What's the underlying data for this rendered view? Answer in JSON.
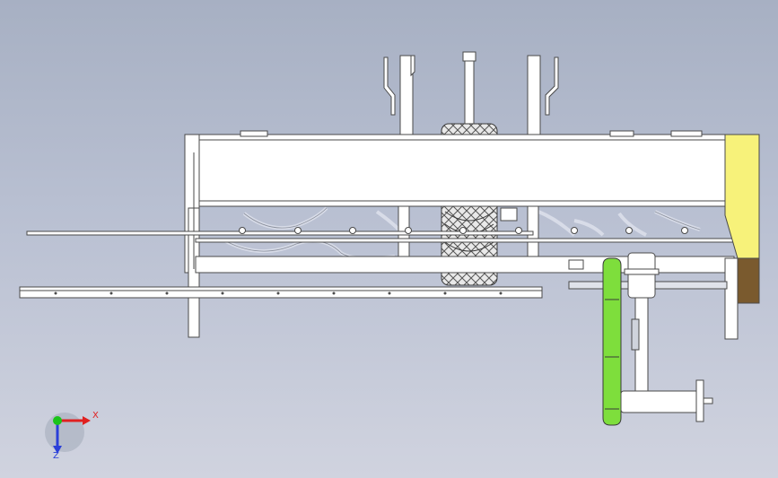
{
  "viewport": {
    "background_top": "#a7b0c3",
    "background_bottom": "#d0d3df"
  },
  "model": {
    "frame_color": "#ffffff",
    "edge_color": "#4a4a4a",
    "end_plate_color": "#f7f27a",
    "end_block_color": "#7a5a2e",
    "belt_guard_color": "#7ede3c",
    "tire_color": "#e6e6e6"
  },
  "triad": {
    "x_label": "X",
    "z_label": "Z",
    "x_color": "#e02020",
    "y_color": "#19c419",
    "z_color": "#2a3fd9"
  }
}
